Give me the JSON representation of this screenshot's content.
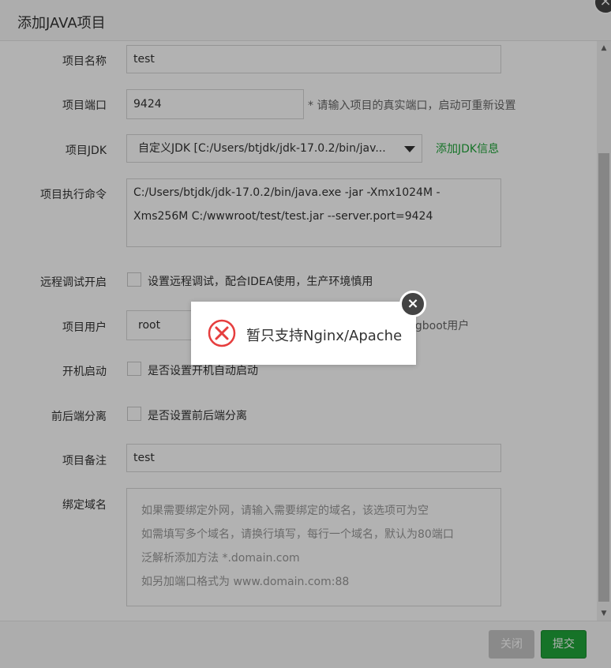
{
  "dialog": {
    "title": "添加JAVA项目",
    "close_icon": "×"
  },
  "form": {
    "name": {
      "label": "项目名称",
      "value": "test"
    },
    "port": {
      "label": "项目端口",
      "value": "9424",
      "hint": "* 请输入项目的真实端口，启动可重新设置"
    },
    "jdk": {
      "label": "项目JDK",
      "value": "自定义JDK [C:/Users/btjdk/jdk-17.0.2/bin/jav...",
      "add_link": "添加JDK信息"
    },
    "command": {
      "label": "项目执行命令",
      "lines": [
        "C:/Users/btjdk/jdk-17.0.2/bin/java.exe -jar -Xmx1024M -",
        "Xms256M  C:/wwwroot/test/test.jar --server.port=9424"
      ]
    },
    "remote_debug": {
      "label": "远程调试开启",
      "checkbox_label": "设置远程调试，配合IDEA使用，生产环境慎用"
    },
    "user": {
      "label": "项目用户",
      "value": "root",
      "hint_tail": "ngboot用户"
    },
    "autostart": {
      "label": "开机启动",
      "checkbox_label": "是否设置开机自动启动"
    },
    "separation": {
      "label": "前后端分离",
      "checkbox_label": "是否设置前后端分离"
    },
    "remark": {
      "label": "项目备注",
      "value": "test"
    },
    "domain": {
      "label": "绑定域名",
      "placeholder_lines": [
        "如果需要绑定外网，请输入需要绑定的域名，该选项可为空",
        "如需填写多个域名，请换行填写，每行一个域名，默认为80端口",
        "泛解析添加方法 *.domain.com",
        "如另加端口格式为 www.domain.com:88"
      ]
    }
  },
  "footer": {
    "close_label": "关闭",
    "submit_label": "提交"
  },
  "toast": {
    "message": "暂只支持Nginx/Apache",
    "close_icon": "×"
  },
  "colors": {
    "accent": "#20a53a",
    "error": "#e63e3e"
  }
}
